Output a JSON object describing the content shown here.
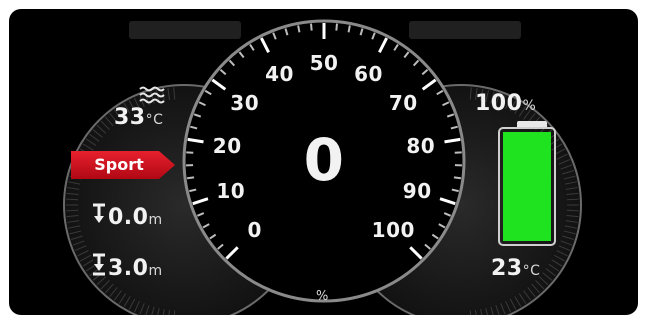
{
  "speed": {
    "value": "0"
  },
  "gauge": {
    "tick_labels": [
      "0",
      "10",
      "20",
      "30",
      "40",
      "50",
      "60",
      "70",
      "80",
      "90",
      "100"
    ],
    "unit": "%"
  },
  "left_panel": {
    "coolant_temp": {
      "icon": "coolant-temperature-icon",
      "value": "33",
      "unit": "°C"
    },
    "mode": {
      "label": "Sport",
      "color": "#d40f1f"
    },
    "trip_a": {
      "icon": "arrow-down-to-line-icon",
      "value": "0.0",
      "unit": "m"
    },
    "trip_b": {
      "icon": "arrow-down-to-double-line-icon",
      "value": "3.0",
      "unit": "m"
    }
  },
  "right_panel": {
    "battery": {
      "percent_value": "100",
      "percent_unit": "%",
      "level": 1.0,
      "color": "#1fe31f"
    },
    "ambient_temp": {
      "value": "23",
      "unit": "°C"
    }
  }
}
